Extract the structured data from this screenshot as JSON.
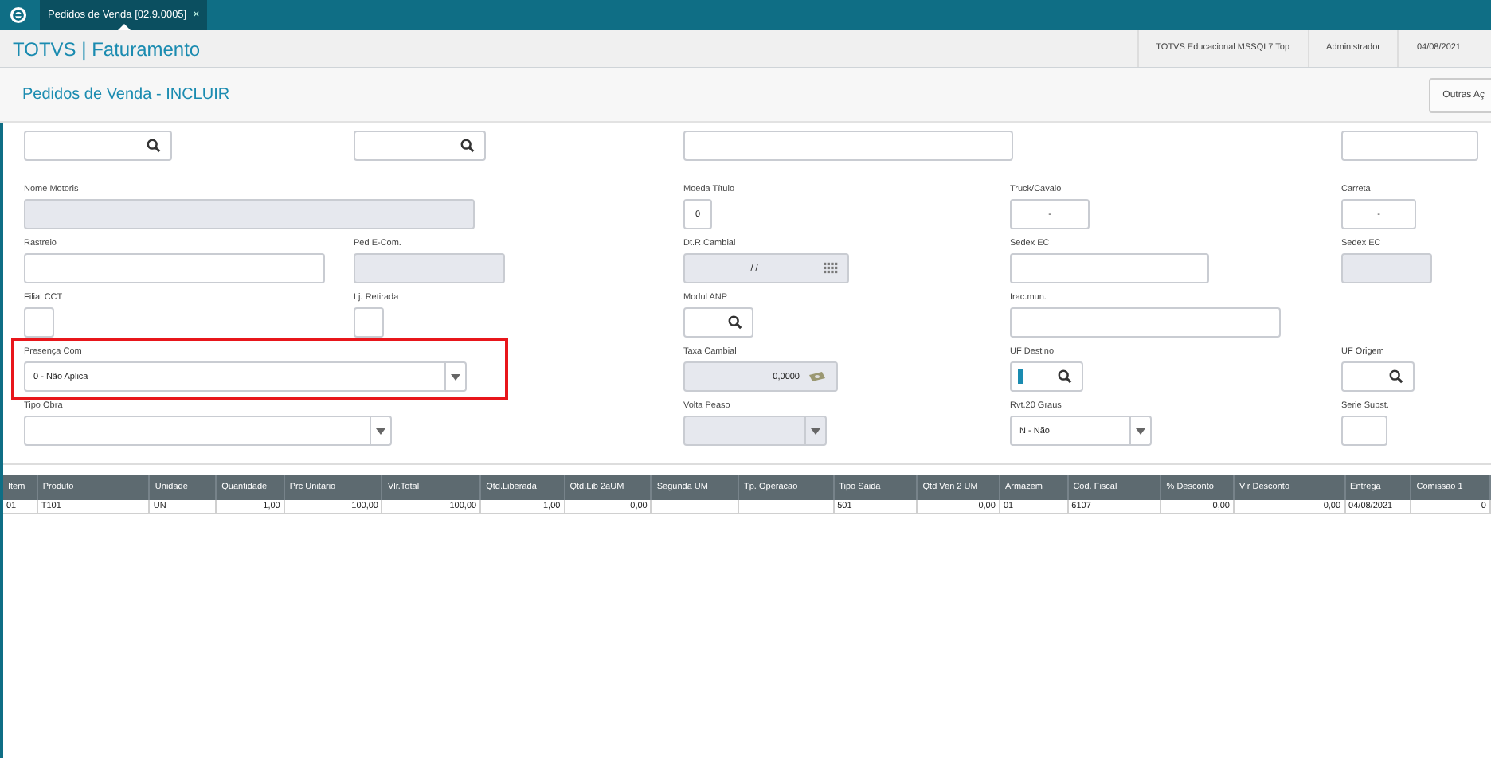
{
  "tab": {
    "label": "Pedidos de Venda [02.9.0005]",
    "close": "×",
    "selected": true
  },
  "header": {
    "title": "TOTVS | Faturamento",
    "environment": "TOTVS Educacional MSSQL7 Top",
    "user": "Administrador",
    "date": "04/08/2021"
  },
  "page": {
    "title": "Pedidos de Venda - INCLUIR",
    "button": "Outras Aç"
  },
  "form_rows": [
    [
      {
        "kind": "lookup",
        "disabled": false,
        "focused": false,
        "highlighted": false
      },
      {
        "kind": "lookup",
        "disabled": false,
        "focused": false,
        "highlighted": false
      },
      {
        "kind": "text",
        "disabled": false,
        "focused": false,
        "highlighted": false
      },
      {
        "kind": "text",
        "disabled": false,
        "focused": false,
        "highlighted": false
      }
    ],
    [
      {
        "kind": "text",
        "label": "Nome Motoris",
        "disabled": true,
        "focused": false,
        "highlighted": false
      },
      {
        "kind": "text",
        "label": "Moeda Título",
        "value": "0",
        "disabled": false,
        "focused": false,
        "highlighted": false
      },
      {
        "kind": "text",
        "label": "Truck/Cavalo",
        "value": "-",
        "disabled": false,
        "focused": false,
        "highlighted": false
      },
      {
        "kind": "text",
        "label": "Carreta",
        "value": "-",
        "disabled": false,
        "focused": false,
        "highlighted": false
      }
    ],
    [
      {
        "kind": "text",
        "label": "Rastreio",
        "disabled": false,
        "focused": false,
        "highlighted": false
      },
      {
        "kind": "text",
        "label": "Ped E-Com.",
        "disabled": true,
        "focused": false,
        "highlighted": false
      },
      {
        "kind": "date",
        "label": "Dt.R.Cambial",
        "value": "/ /",
        "disabled": true,
        "focused": false,
        "highlighted": false
      },
      {
        "kind": "text",
        "label": "Sedex EC",
        "disabled": false,
        "focused": false,
        "highlighted": false
      },
      {
        "kind": "text",
        "label": "Sedex EC",
        "disabled": true,
        "focused": false,
        "highlighted": false
      }
    ],
    [
      {
        "kind": "text",
        "label": "Filial CCT",
        "disabled": false,
        "focused": false,
        "highlighted": false
      },
      {
        "kind": "text",
        "label": "Lj. Retirada",
        "disabled": false,
        "focused": false,
        "highlighted": false
      },
      {
        "kind": "lookup",
        "label": "Modul ANP",
        "disabled": false,
        "focused": false,
        "highlighted": false
      },
      {
        "kind": "text",
        "label": "Irac.mun.",
        "disabled": false,
        "focused": false,
        "highlighted": false
      }
    ],
    [
      {
        "kind": "select",
        "label": "Presença Com",
        "value": "0 - Não Aplica",
        "disabled": false,
        "focused": false,
        "highlighted": true
      },
      {
        "kind": "money",
        "label": "Taxa Cambial",
        "value": "0,0000",
        "disabled": true,
        "focused": false,
        "highlighted": false
      },
      {
        "kind": "lookup",
        "label": "UF Destino",
        "disabled": false,
        "focused": true,
        "highlighted": false
      },
      {
        "kind": "lookup",
        "label": "UF Origem",
        "disabled": false,
        "focused": false,
        "highlighted": false
      }
    ],
    [
      {
        "kind": "select",
        "label": "Tipo Obra",
        "disabled": false,
        "focused": false,
        "highlighted": false
      },
      {
        "kind": "select",
        "label": "Volta Peaso",
        "disabled": true,
        "focused": false,
        "highlighted": false
      },
      {
        "kind": "select",
        "label": "Rvt.20 Graus",
        "value": "N - Não",
        "disabled": false,
        "focused": false,
        "highlighted": false
      },
      {
        "kind": "text",
        "label": "Serie Subst.",
        "disabled": false,
        "focused": false,
        "highlighted": false
      }
    ]
  ],
  "table": {
    "columns": [
      {
        "label": "Item",
        "kind": "text"
      },
      {
        "label": "Produto",
        "kind": "text"
      },
      {
        "label": "Unidade",
        "kind": "text"
      },
      {
        "label": "Quantidade",
        "kind": "number"
      },
      {
        "label": "Prc Unitario",
        "kind": "number"
      },
      {
        "label": "Vlr.Total",
        "kind": "number"
      },
      {
        "label": "Qtd.Liberada",
        "kind": "number"
      },
      {
        "label": "Qtd.Lib 2aUM",
        "kind": "number"
      },
      {
        "label": "Segunda UM",
        "kind": "text"
      },
      {
        "label": "Tp. Operacao",
        "kind": "text"
      },
      {
        "label": "Tipo Saida",
        "kind": "text"
      },
      {
        "label": "Qtd Ven 2 UM",
        "kind": "number"
      },
      {
        "label": "Armazem",
        "kind": "text"
      },
      {
        "label": "Cod. Fiscal",
        "kind": "text"
      },
      {
        "label": "% Desconto",
        "kind": "number"
      },
      {
        "label": "Vlr Desconto",
        "kind": "number"
      },
      {
        "label": "Entrega",
        "kind": "text"
      },
      {
        "label": "Comissao 1",
        "kind": "number"
      }
    ],
    "rows": [
      [
        "01",
        "T101",
        "UN",
        "1,00",
        "100,00",
        "100,00",
        "1,00",
        "0,00",
        null,
        null,
        "501",
        "0,00",
        "01",
        "6107",
        "0,00",
        "0,00",
        "04/08/2021",
        "0"
      ]
    ]
  }
}
